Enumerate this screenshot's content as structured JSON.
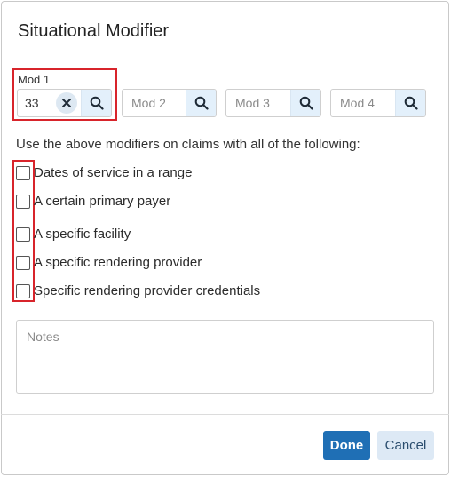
{
  "dialog": {
    "title": "Situational Modifier"
  },
  "modifiers": {
    "mod1_label": "Mod 1",
    "mod1_value": "33",
    "fields": [
      {
        "placeholder": "Mod 2"
      },
      {
        "placeholder": "Mod 3"
      },
      {
        "placeholder": "Mod 4"
      }
    ]
  },
  "instruction": "Use the above modifiers on claims with all of the following:",
  "conditions": [
    {
      "label": "Dates of service in a range",
      "checked": false
    },
    {
      "label": "A certain primary payer",
      "checked": false
    },
    {
      "label": "A specific facility",
      "checked": false
    },
    {
      "label": "A specific rendering provider",
      "checked": false
    },
    {
      "label": "Specific rendering provider credentials",
      "checked": false
    }
  ],
  "notes": {
    "placeholder": "Notes"
  },
  "footer": {
    "done_label": "Done",
    "cancel_label": "Cancel"
  },
  "colors": {
    "primary": "#1f6fb5",
    "highlight": "#d8242b",
    "search_bg": "#e3f0fb"
  }
}
